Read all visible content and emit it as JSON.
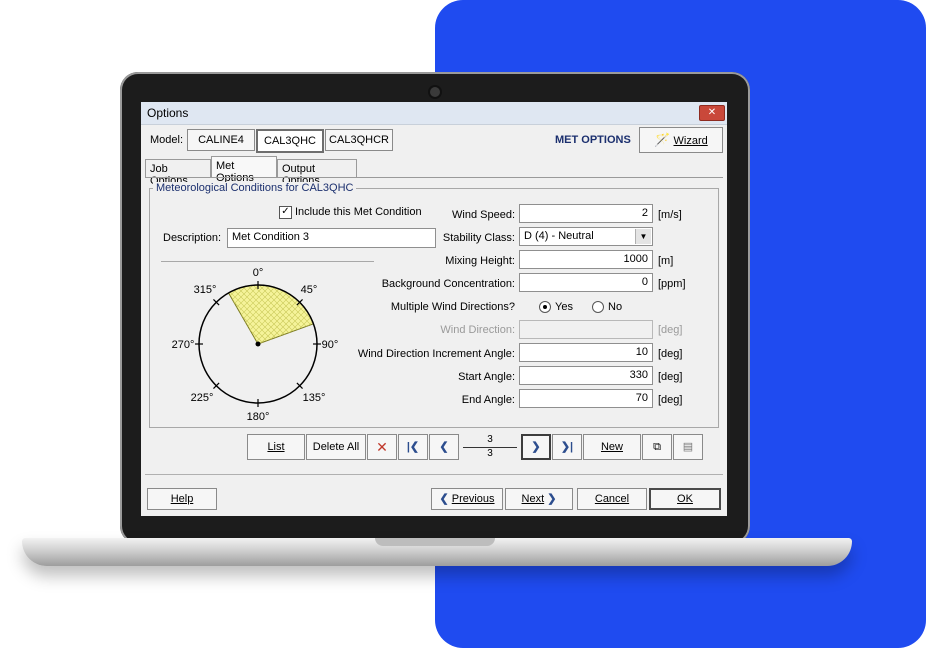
{
  "window": {
    "title": "Options",
    "close_icon": "close-icon"
  },
  "model": {
    "label": "Model:",
    "buttons": [
      "CALINE4",
      "CAL3QHC",
      "CAL3QHCR"
    ],
    "selected": "CAL3QHC"
  },
  "header": {
    "met_options": "MET OPTIONS",
    "wizard_label": "Wizard",
    "wizard_icon": "wand-icon"
  },
  "tabs": [
    "Job Options",
    "Met Options",
    "Output Options"
  ],
  "active_tab": "Met Options",
  "group": {
    "title": "Meteorological Conditions for CAL3QHC",
    "include_label": "Include this Met Condition",
    "include_checked": true,
    "description_label": "Description:",
    "description_value": "Met Condition 3"
  },
  "compass": {
    "labels": {
      "n": "0°",
      "ne": "45°",
      "e": "90°",
      "se": "135°",
      "s": "180°",
      "sw": "225°",
      "w": "270°",
      "nw": "315°"
    },
    "sector_start": 330,
    "sector_end": 70,
    "sector_color": "#f5f39a"
  },
  "fields": {
    "wind_speed": {
      "label": "Wind Speed:",
      "value": "2",
      "unit": "[m/s]"
    },
    "stability_class": {
      "label": "Stability Class:",
      "value": "D (4) - Neutral"
    },
    "mixing_height": {
      "label": "Mixing Height:",
      "value": "1000",
      "unit": "[m]"
    },
    "background_concentration": {
      "label": "Background Concentration:",
      "value": "0",
      "unit": "[ppm]"
    },
    "multiple_wind": {
      "label": "Multiple Wind Directions?",
      "yes": "Yes",
      "no": "No",
      "selected": "Yes"
    },
    "wind_direction": {
      "label": "Wind Direction:",
      "value": "",
      "unit": "[deg]"
    },
    "increment_angle": {
      "label": "Wind Direction Increment Angle:",
      "value": "10",
      "unit": "[deg]"
    },
    "start_angle": {
      "label": "Start Angle:",
      "value": "330",
      "unit": "[deg]"
    },
    "end_angle": {
      "label": "End Angle:",
      "value": "70",
      "unit": "[deg]"
    }
  },
  "navbar": {
    "list": "List",
    "delete_all": "Delete All",
    "record_current": "3",
    "record_total": "3",
    "new": "New"
  },
  "footer": {
    "help": "Help",
    "previous": "Previous",
    "next": "Next",
    "cancel": "Cancel",
    "ok": "OK"
  },
  "colors": {
    "brand_blue": "#1f4bf0",
    "title_blue": "#1b2f6e"
  }
}
